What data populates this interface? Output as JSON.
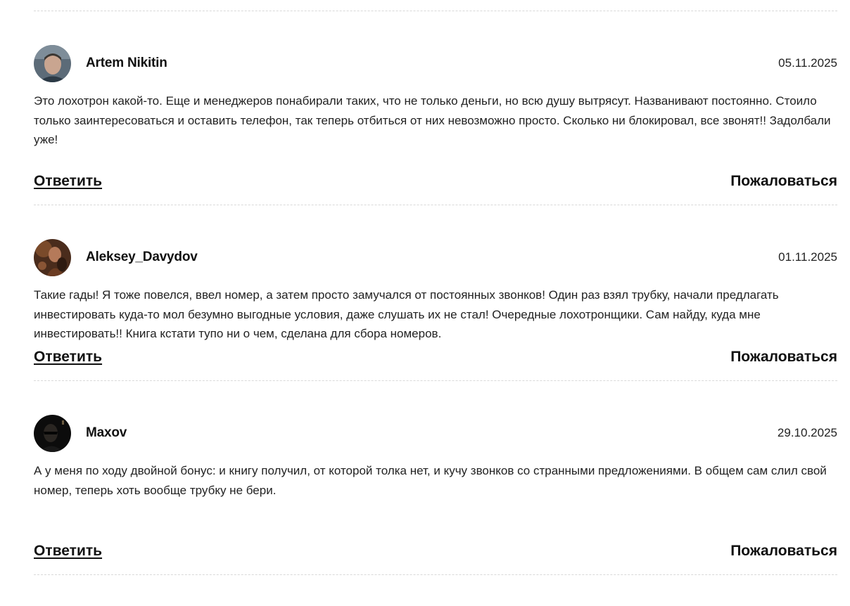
{
  "comments": [
    {
      "author": "Artem Nikitin",
      "date": "05.11.2025",
      "text": "Это лохотрон какой-то. Еще и менеджеров понабирали таких, что не только деньги, но всю душу вытрясут. Названивают постоянно. Стоило только заинтересоваться и оставить телефон, так теперь отбиться от них невозможно просто. Сколько ни блокировал, все звонят!! Задолбали уже!",
      "reply_label": "Ответить",
      "report_label": "Пожаловаться"
    },
    {
      "author": "Aleksey_Davydov",
      "date": "01.11.2025",
      "text": "Такие гады! Я тоже повелся, ввел номер, а затем просто замучался от постоянных звонков! Один раз взял трубку, начали предлагать инвестировать куда-то мол безумно выгодные условия, даже слушать их не стал! Очередные лохотронщики. Сам найду, куда мне инвестировать!! Книга кстати тупо ни о чем, сделана для сбора номеров.",
      "reply_label": "Ответить",
      "report_label": "Пожаловаться"
    },
    {
      "author": "Maxov",
      "date": "29.10.2025",
      "text": "А у меня по ходу двойной бонус: и книгу получил, от которой толка нет, и кучу звонков со странными предложениями. В общем сам слил свой номер, теперь хоть вообще трубку не бери.",
      "reply_label": "Ответить",
      "report_label": "Пожаловаться"
    }
  ]
}
